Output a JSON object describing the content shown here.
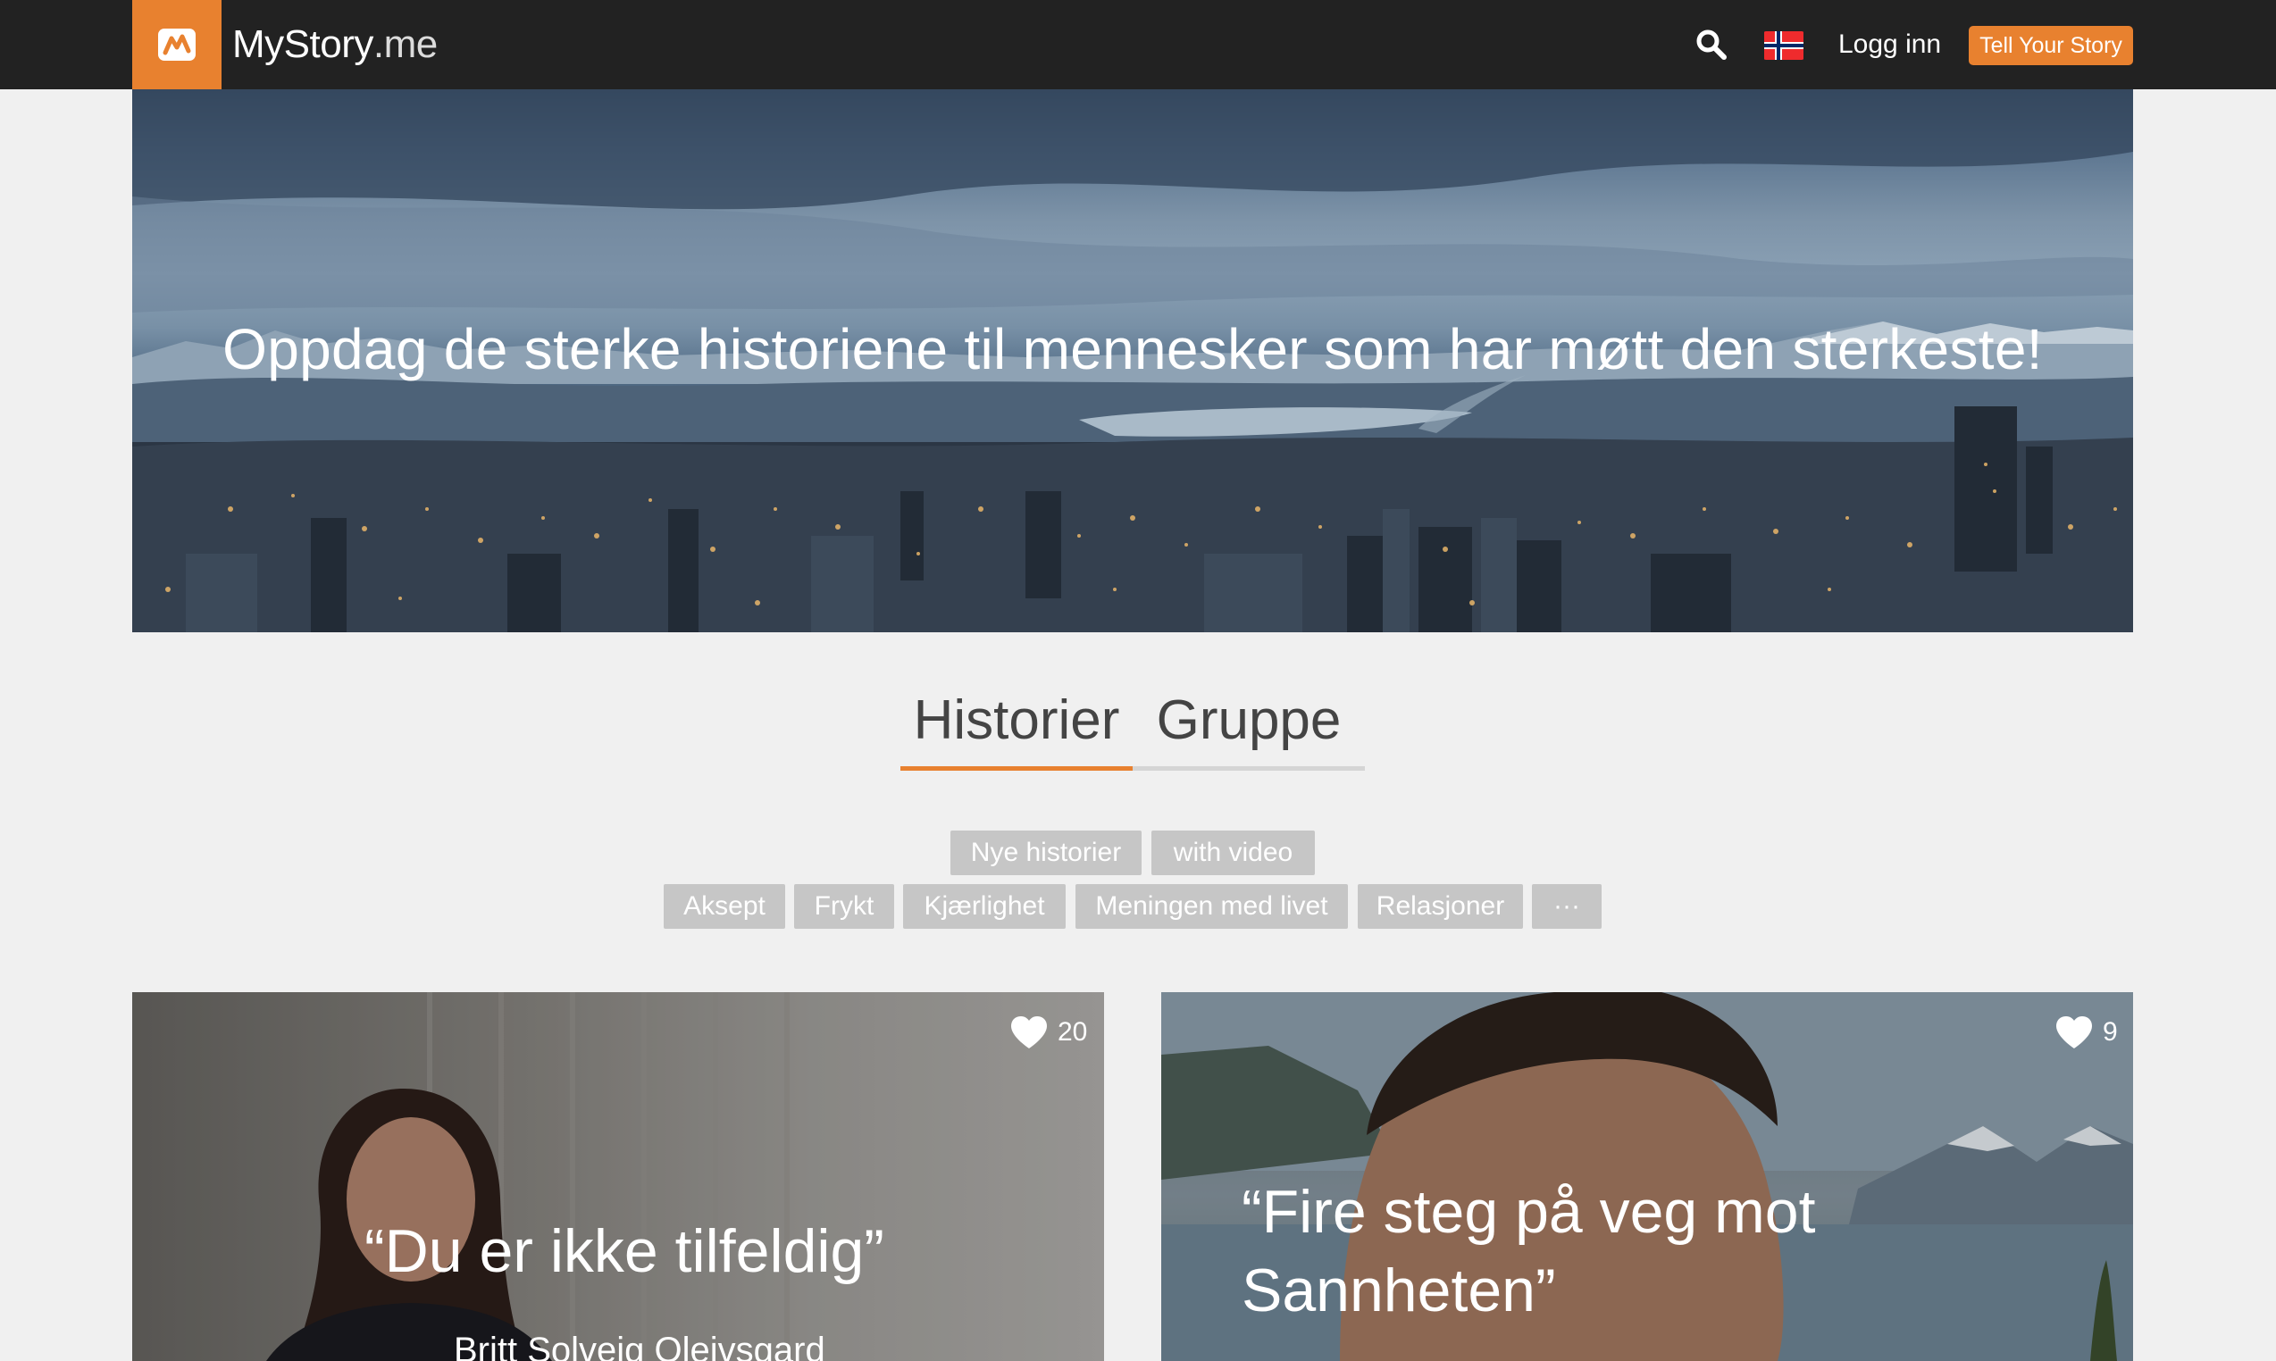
{
  "header": {
    "brand_main": "MyStory",
    "brand_suffix": ".me",
    "login_label": "Logg inn",
    "cta_label": "Tell Your Story",
    "accent_color": "#e8812f",
    "icons": [
      "logo-mark-icon",
      "search-icon",
      "norwegian-flag-icon"
    ]
  },
  "hero": {
    "title": "Oppdag de sterke historiene til mennesker som har møtt den sterkeste!"
  },
  "tabs": [
    {
      "label": "Historier",
      "active": true
    },
    {
      "label": "Gruppe",
      "active": false
    }
  ],
  "filters": {
    "row1": [
      "Nye historier",
      "with video"
    ],
    "row2": [
      "Aksept",
      "Frykt",
      "Kjærlighet",
      "Meningen med livet",
      "Relasjoner",
      "···"
    ]
  },
  "cards": [
    {
      "likes": "20",
      "quote": "“Du er ikke tilfeldig”",
      "author": "Britt Solveig Oleivsgard"
    },
    {
      "likes": "9",
      "quote_line1": "“Fire steg på veg mot",
      "quote_line2": "Sannheten”"
    }
  ]
}
